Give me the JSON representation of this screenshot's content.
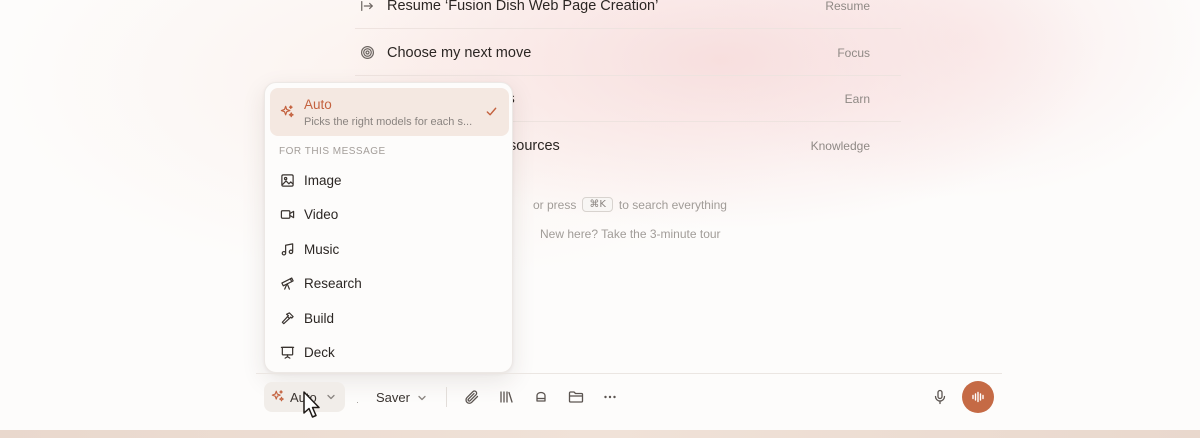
{
  "suggestions": [
    {
      "icon": "arrow-into-icon",
      "title": "Resume ‘Fusion Dish Web Page Creation’",
      "tag": "Resume"
    },
    {
      "icon": "target-icon",
      "title": "Choose my next move",
      "tag": "Focus"
    },
    {
      "icon": "coins-icon",
      "title": "lits",
      "tag": "Earn"
    },
    {
      "icon": "book-icon",
      "title": "sources",
      "tag": "Knowledge"
    }
  ],
  "hint": {
    "prefix": "or press",
    "shortcut": "⌘K",
    "suffix": "to search everything"
  },
  "tour_text": "New here? Take the 3-minute tour",
  "menu": {
    "selected": {
      "title": "Auto",
      "subtitle": "Picks the right models for each s..."
    },
    "section_label": "FOR THIS MESSAGE",
    "items": [
      {
        "icon": "image-icon",
        "label": "Image"
      },
      {
        "icon": "video-icon",
        "label": "Video"
      },
      {
        "icon": "music-icon",
        "label": "Music"
      },
      {
        "icon": "telescope-icon",
        "label": "Research"
      },
      {
        "icon": "hammer-icon",
        "label": "Build"
      },
      {
        "icon": "presentation-icon",
        "label": "Deck"
      }
    ]
  },
  "toolbar": {
    "model_label": "Auto",
    "mode_dot": "·",
    "mode_label": "Saver",
    "icons": [
      "paperclip-icon",
      "library-icon",
      "graduation-cap-icon",
      "folder-icon",
      "more-icon"
    ],
    "mic_icon": "microphone-icon",
    "voice_icon": "waveform-icon"
  },
  "colors": {
    "accent": "#c4623f",
    "voice_button": "#c56a45",
    "selected_bg": "#f4e8e1"
  }
}
